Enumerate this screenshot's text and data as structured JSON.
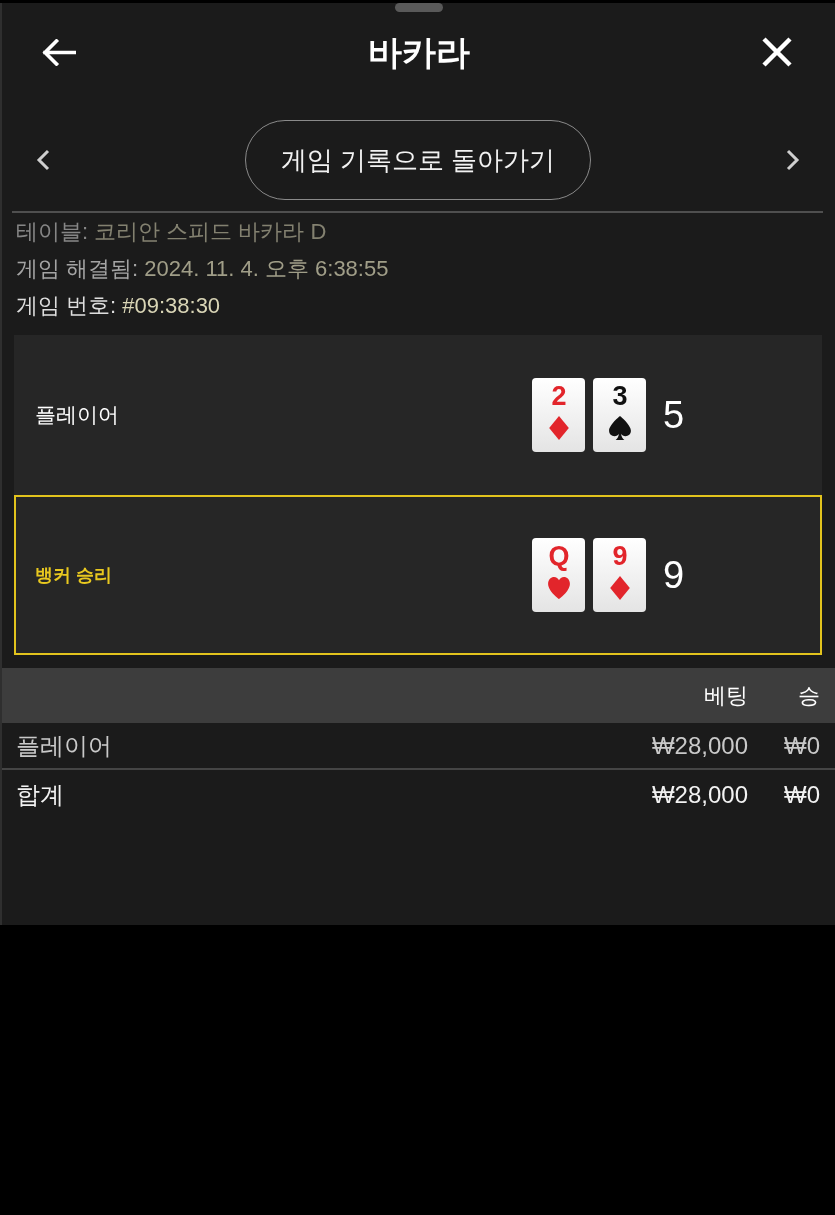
{
  "header": {
    "title": "바카라"
  },
  "nav": {
    "button": "게임 기록으로 돌아가기"
  },
  "details": [
    {
      "label": "테이블:",
      "value": "코리안 스피드 바카라 D"
    },
    {
      "label": "게임 해결됨:",
      "value": "2024. 11. 4. 오후 6:38:55"
    },
    {
      "label": "게임 번호:",
      "value": "#09:38:30"
    }
  ],
  "hands": [
    {
      "label": "플레이어",
      "winner": false,
      "cards": [
        {
          "rank": "2",
          "kind": "diamond"
        },
        {
          "rank": "3",
          "kind": "spade"
        }
      ],
      "score": "5"
    },
    {
      "label": "뱅커 승리",
      "winner": true,
      "cards": [
        {
          "rank": "Q",
          "kind": "heart"
        },
        {
          "rank": "9",
          "kind": "diamond"
        }
      ],
      "score": "9"
    }
  ],
  "bets": {
    "columns": [
      "",
      "베팅",
      "승"
    ],
    "rows": [
      {
        "kind": "bet",
        "cells": [
          "플레이어",
          "₩28,000",
          "₩0"
        ]
      },
      {
        "kind": "total",
        "cells": [
          "합계",
          "₩28,000",
          "₩0"
        ]
      }
    ]
  }
}
